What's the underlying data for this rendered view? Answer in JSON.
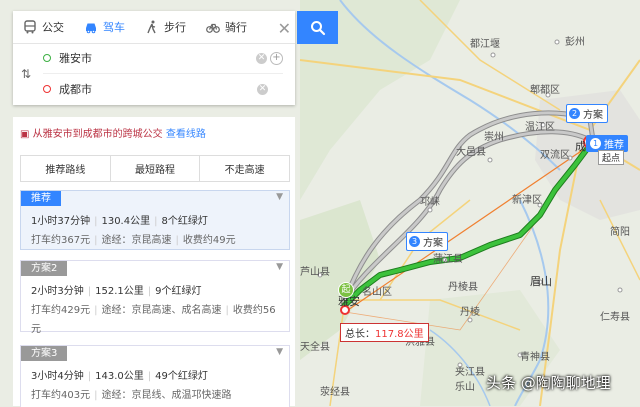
{
  "modes": [
    {
      "label": "公交",
      "icon": "bus-icon"
    },
    {
      "label": "驾车",
      "icon": "car-icon",
      "active": true
    },
    {
      "label": "步行",
      "icon": "walk-icon"
    },
    {
      "label": "骑行",
      "icon": "bike-icon"
    }
  ],
  "search": {
    "start": "雅安市",
    "end": "成都市",
    "start_color": "#3cb043",
    "end_color": "#e33"
  },
  "notice": {
    "text": "从雅安市到成都市的跨城公交",
    "link": "查看线路"
  },
  "tabs": [
    "推荐路线",
    "最短路程",
    "不走高速"
  ],
  "routes": [
    {
      "badge": "推荐",
      "time": "1小时37分钟",
      "distance": "130.4公里",
      "lights": "8个红绿灯",
      "taxi": "打车约367元",
      "via": "途经：京昆高速",
      "toll": "收费约49元",
      "selected": true
    },
    {
      "badge": "方案2",
      "time": "2小时3分钟",
      "distance": "152.1公里",
      "lights": "9个红绿灯",
      "taxi": "打车约429元",
      "via": "途经：京昆高速、成名高速",
      "toll": "收费约56",
      "toll_wrap": "元"
    },
    {
      "badge": "方案3",
      "time": "3小时4分钟",
      "distance": "143.0公里",
      "lights": "49个红绿灯",
      "taxi": "打车约403元",
      "via": "途经：京昆线、成温邛快速路"
    }
  ],
  "map": {
    "places": [
      {
        "name": "彭州",
        "pos": "l"
      },
      {
        "name": "都江堰",
        "pos": "l"
      },
      {
        "name": "郫都区",
        "pos": "l"
      },
      {
        "name": "温江区",
        "pos": "l"
      },
      {
        "name": "双流区",
        "pos": "l"
      },
      {
        "name": "成都",
        "pos": "l"
      },
      {
        "name": "大邑县",
        "pos": "l"
      },
      {
        "name": "崇州",
        "pos": "l"
      },
      {
        "name": "新津区",
        "pos": "l"
      },
      {
        "name": "邛崃",
        "pos": "l"
      },
      {
        "name": "蒲江县",
        "pos": "l"
      },
      {
        "name": "眉山",
        "pos": "l"
      },
      {
        "name": "丹棱县",
        "pos": "l"
      },
      {
        "name": "芦山县",
        "pos": "l"
      },
      {
        "name": "雅安",
        "pos": "l"
      },
      {
        "name": "名山区",
        "pos": "l"
      },
      {
        "name": "丹棱",
        "pos": "l"
      },
      {
        "name": "洪雅县",
        "pos": "l"
      },
      {
        "name": "乐山",
        "pos": "l"
      },
      {
        "name": "简阳",
        "pos": "l"
      },
      {
        "name": "仁寿县",
        "pos": "l"
      },
      {
        "name": "青神县",
        "pos": "l"
      },
      {
        "name": "夹江县",
        "pos": "l"
      },
      {
        "name": "天全县",
        "pos": "l"
      },
      {
        "name": "荥经县",
        "pos": "l"
      }
    ],
    "plan2": "方案",
    "plan3": "方案",
    "recommend": "推荐",
    "start_tag": "起点",
    "distance_label": "总长：",
    "distance_value": "117.8公里",
    "qi": "起",
    "watermark": "头条 @陶陶聊地理",
    "plan2_num": "2",
    "plan3_num": "3",
    "rec_num": "1"
  }
}
